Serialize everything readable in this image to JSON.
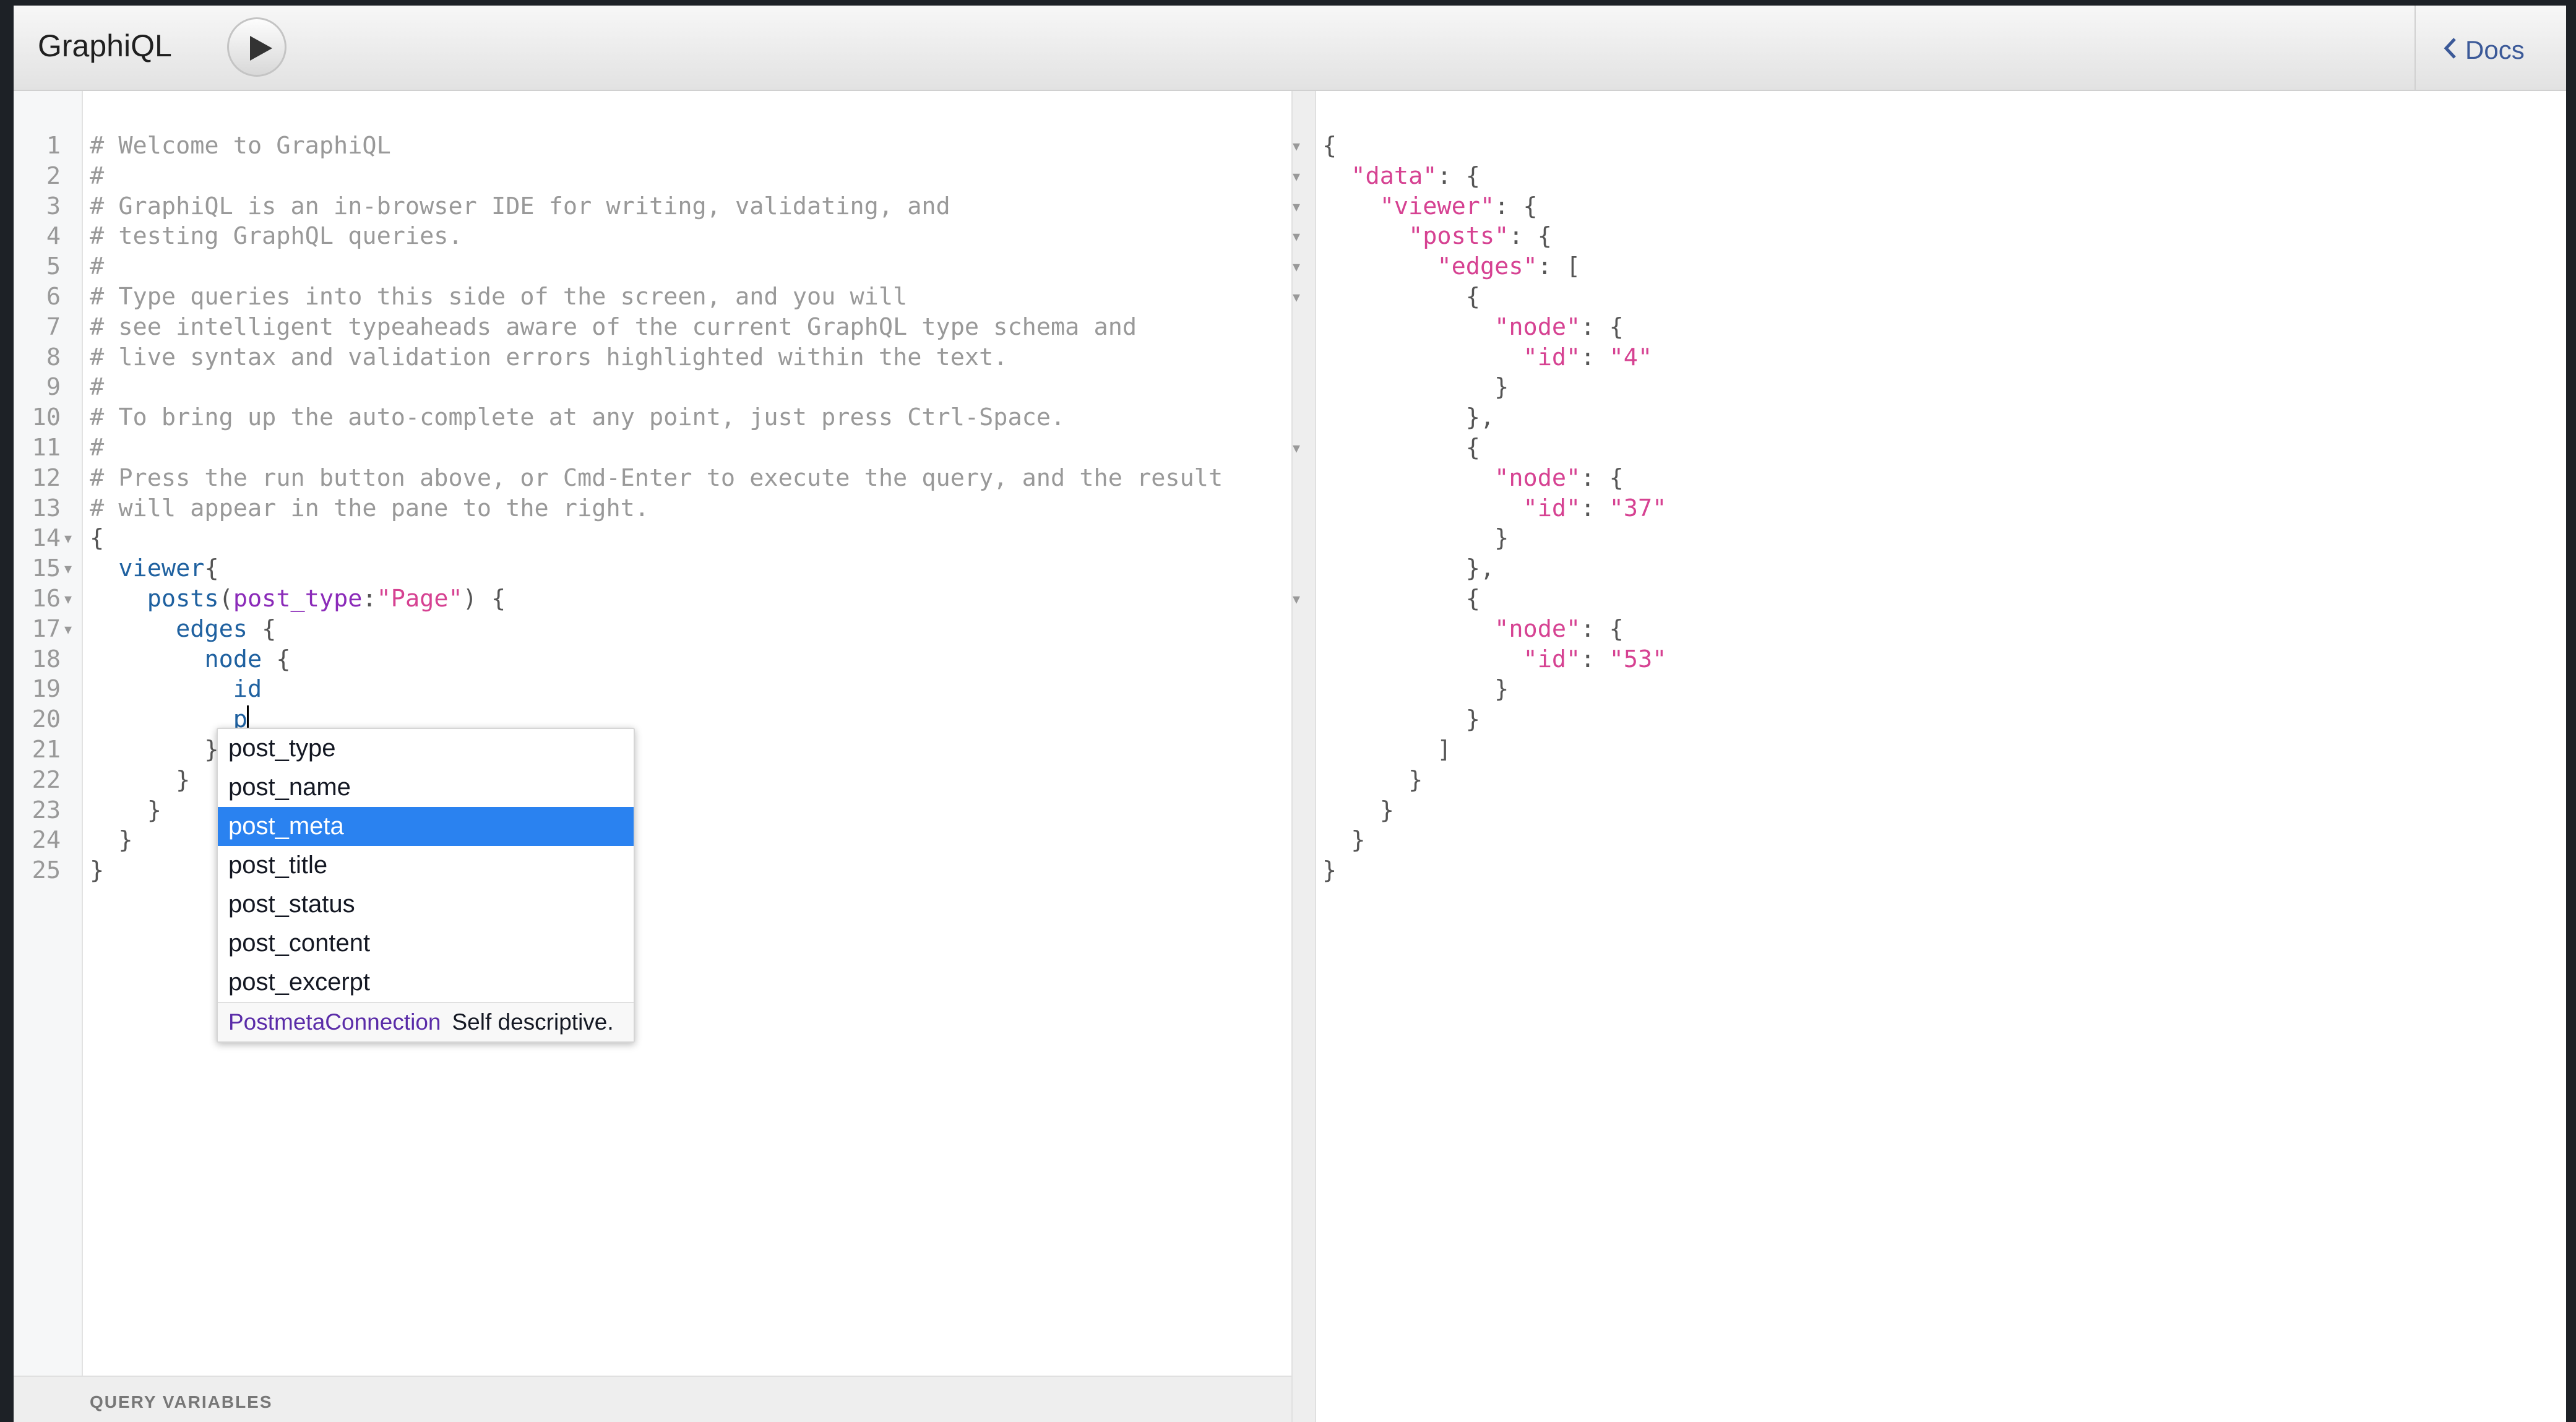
{
  "app": {
    "logo": "GraphiQL",
    "docs_label": "Docs"
  },
  "icons": {
    "run": "play-icon",
    "docs": "chevron-left-icon"
  },
  "colors": {
    "comment": "#999999",
    "field": "#1f61a0",
    "attribute": "#8b2bb9",
    "string": "#d64292",
    "hint_active_bg": "#2a82f0"
  },
  "editor": {
    "line_numbers": [
      "1",
      "2",
      "3",
      "4",
      "5",
      "6",
      "7",
      "8",
      "9",
      "10",
      "11",
      "12",
      "13",
      "14",
      "15",
      "16",
      "17",
      "18",
      "19",
      "20",
      "21",
      "22",
      "23",
      "24",
      "25"
    ],
    "comments": [
      "# Welcome to GraphiQL",
      "#",
      "# GraphiQL is an in-browser IDE for writing, validating, and",
      "# testing GraphQL queries.",
      "#",
      "# Type queries into this side of the screen, and you will",
      "# see intelligent typeaheads aware of the current GraphQL type schema and",
      "# live syntax and validation errors highlighted within the text.",
      "#",
      "# To bring up the auto-complete at any point, just press Ctrl-Space.",
      "#",
      "# Press the run button above, or Cmd-Enter to execute the query, and the result",
      "# will appear in the pane to the right."
    ],
    "query": {
      "viewer": "viewer",
      "posts": "posts",
      "arg_name": "post_type",
      "arg_value": "\"Page\"",
      "edges": "edges",
      "node": "node",
      "id": "id",
      "typed": "p"
    },
    "query_variables_label": "QUERY VARIABLES"
  },
  "autocomplete": {
    "items": [
      "post_type",
      "post_name",
      "post_meta",
      "post_title",
      "post_status",
      "post_content",
      "post_excerpt"
    ],
    "active_item": "post_meta",
    "info_type": "PostmetaConnection",
    "info_description": "Self descriptive."
  },
  "result": {
    "keys": {
      "data": "\"data\"",
      "viewer": "\"viewer\"",
      "posts": "\"posts\"",
      "edges": "\"edges\"",
      "node": "\"node\"",
      "id": "\"id\""
    },
    "ids": [
      "\"4\"",
      "\"37\"",
      "\"53\""
    ]
  }
}
